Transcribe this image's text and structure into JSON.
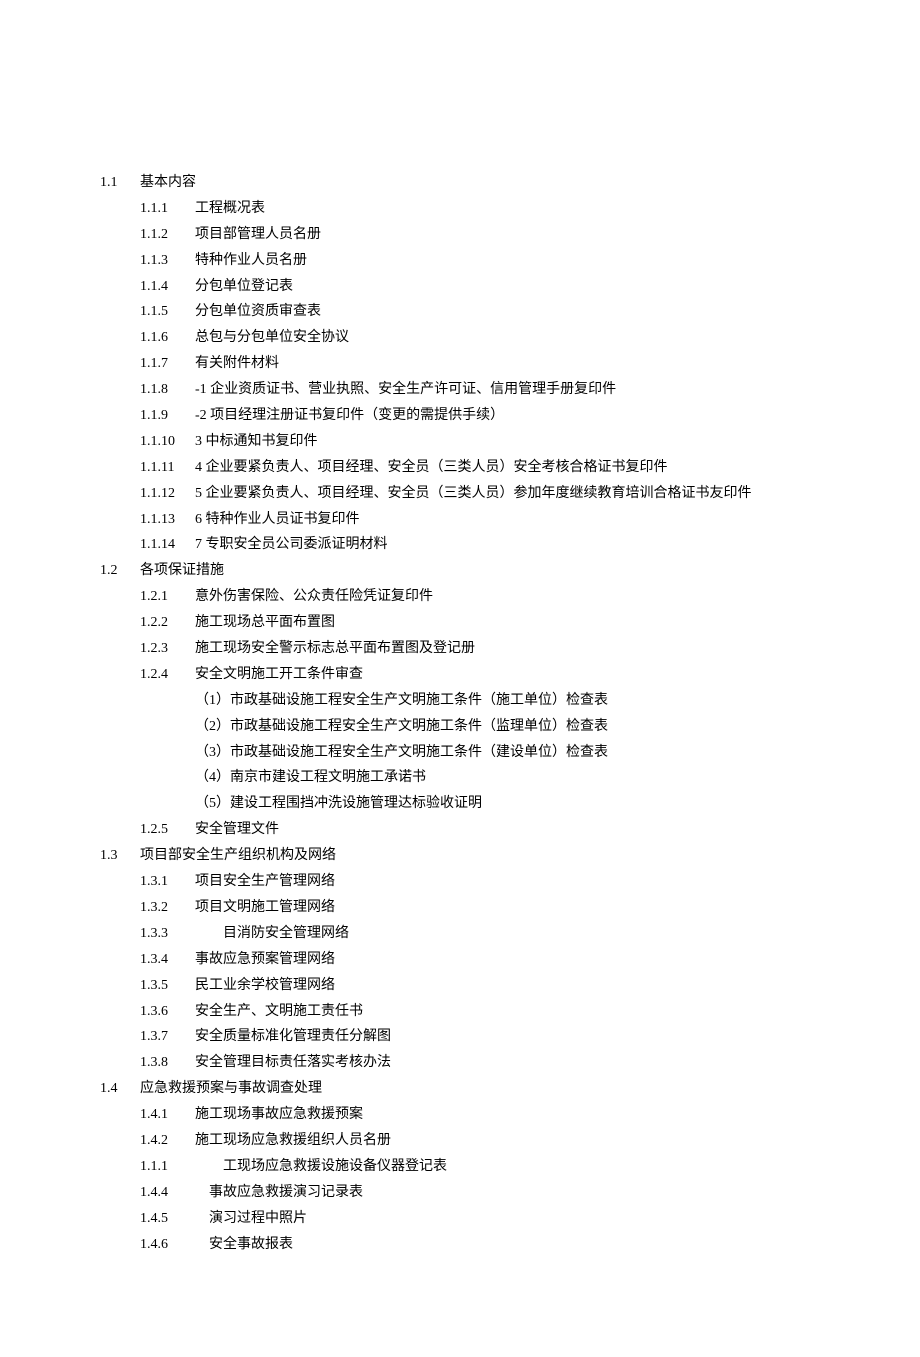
{
  "sections": [
    {
      "num": "1.1",
      "title": "基本内容",
      "items": [
        {
          "num": "1.1.1",
          "text": "工程概况表"
        },
        {
          "num": "1.1.2",
          "text": "项目部管理人员名册"
        },
        {
          "num": "1.1.3",
          "text": "特种作业人员名册"
        },
        {
          "num": "1.1.4",
          "text": "分包单位登记表"
        },
        {
          "num": "1.1.5",
          "text": "分包单位资质审查表"
        },
        {
          "num": "1.1.6",
          "text": "总包与分包单位安全协议"
        },
        {
          "num": "1.1.7",
          "text": "有关附件材料"
        },
        {
          "num": "1.1.8",
          "text": "-1 企业资质证书、营业执照、安全生产许可证、信用管理手册复印件"
        },
        {
          "num": "1.1.9",
          "text": "-2 项目经理注册证书复印件（变更的需提供手续）"
        },
        {
          "num": "1.1.10",
          "text": "3 中标通知书复印件"
        },
        {
          "num": "1.1.11",
          "text": "4 企业要紧负责人、项目经理、安全员（三类人员）安全考核合格证书复印件"
        },
        {
          "num": "1.1.12",
          "text": "5 企业要紧负责人、项目经理、安全员（三类人员）参加年度继续教育培训合格证书友印件"
        },
        {
          "num": "1.1.13",
          "text": "6 特种作业人员证书复印件"
        },
        {
          "num": "1.1.14",
          "text": "7 专职安全员公司委派证明材料"
        }
      ]
    },
    {
      "num": "1.2",
      "title": "各项保证措施",
      "items": [
        {
          "num": "1.2.1",
          "text": "意外伤害保险、公众责任险凭证复印件"
        },
        {
          "num": "1.2.2",
          "text": "施工现场总平面布置图"
        },
        {
          "num": "1.2.3",
          "text": "施工现场安全警示标志总平面布置图及登记册"
        },
        {
          "num": "1.2.4",
          "text": "安全文明施工开工条件审查"
        }
      ],
      "subitems": [
        "（1）市政基础设施工程安全生产文明施工条件（施工单位）检查表",
        "（2）市政基础设施工程安全生产文明施工条件（监理单位）检查表",
        "（3）市政基础设施工程安全生产文明施工条件（建设单位）检查表",
        "（4）南京市建设工程文明施工承诺书",
        "（5）建设工程围挡冲洗设施管理达标验收证明"
      ],
      "items2": [
        {
          "num": "1.2.5",
          "text": "安全管理文件"
        }
      ]
    },
    {
      "num": "1.3",
      "title": "项目部安全生产组织机构及网络",
      "items": [
        {
          "num": "1.3.1",
          "text": "项目安全生产管理网络"
        },
        {
          "num": "1.3.2",
          "text": "项目文明施工管理网络"
        },
        {
          "num": "1.3.3",
          "text": "　　目消防安全管理网络"
        },
        {
          "num": "1.3.4",
          "text": "事故应急预案管理网络"
        },
        {
          "num": "1.3.5",
          "text": "民工业余学校管理网络"
        },
        {
          "num": "1.3.6",
          "text": "安全生产、文明施工责任书"
        },
        {
          "num": "1.3.7",
          "text": "安全质量标准化管理责任分解图"
        },
        {
          "num": "1.3.8",
          "text": "安全管理目标责任落实考核办法"
        }
      ]
    },
    {
      "num": "1.4",
      "title": "应急救援预案与事故调查处理",
      "items": [
        {
          "num": "1.4.1",
          "text": "施工现场事故应急救援预案"
        },
        {
          "num": "1.4.2",
          "text": "施工现场应急救援组织人员名册"
        },
        {
          "num": "1.1.1",
          "text": "　　工现场应急救援设施设备仪器登记表"
        },
        {
          "num": "1.4.4",
          "text": "　事故应急救援演习记录表"
        },
        {
          "num": "1.4.5",
          "text": "　演习过程中照片"
        },
        {
          "num": "1.4.6",
          "text": "　安全事故报表"
        }
      ]
    }
  ]
}
